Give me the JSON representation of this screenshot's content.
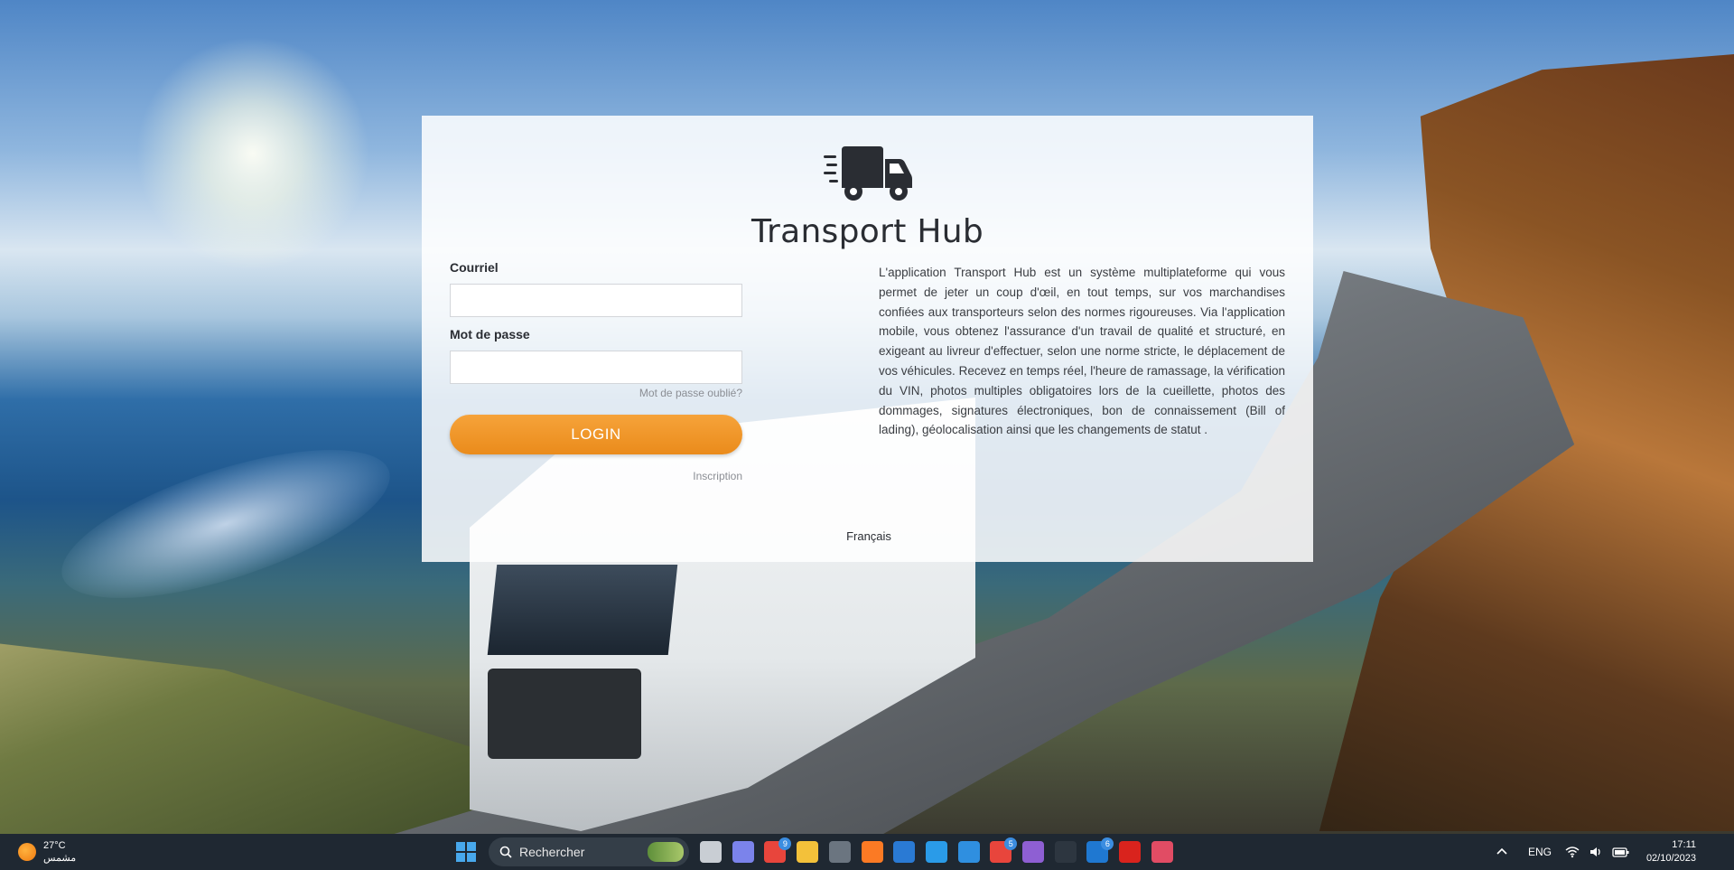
{
  "app": {
    "title": "Transport Hub",
    "logo_icon": "truck-icon",
    "accent_color": "#EE921F"
  },
  "form": {
    "email_label": "Courriel",
    "email_value": "",
    "password_label": "Mot de passe",
    "password_value": "",
    "forgot_password": "Mot de passe oublié?",
    "login_button": "LOGIN",
    "signup_link": "Inscription"
  },
  "description": "L'application Transport Hub est un système multiplateforme qui vous permet de jeter un coup d'œil, en tout temps, sur vos marchandises confiées aux transporteurs selon des normes rigoureuses. Via l'application mobile, vous obtenez l'assurance d'un travail de qualité et structuré, en exigeant au livreur d'effectuer, selon une norme stricte, le déplacement de vos véhicules. Recevez en temps réel, l'heure de ramassage, la vérification du VIN, photos multiples obligatoires lors de la cueillette, photos des dommages, signatures électroniques, bon de connaissement (Bill of lading), géolocalisation ainsi que les changements de statut .",
  "language": "Français",
  "taskbar": {
    "weather_temp": "27°C",
    "weather_desc": "مشمس",
    "search_placeholder": "Rechercher",
    "apps": [
      {
        "name": "task-view-icon",
        "color": "#c9ced4"
      },
      {
        "name": "teams-icon",
        "color": "#7b83eb"
      },
      {
        "name": "chrome-icon",
        "color": "#e8453c",
        "badge": "9"
      },
      {
        "name": "file-explorer-icon",
        "color": "#f3c13a"
      },
      {
        "name": "calculator-icon",
        "color": "#6b7580"
      },
      {
        "name": "xampp-icon",
        "color": "#fb7a24"
      },
      {
        "name": "mail-icon",
        "color": "#2a7ad4"
      },
      {
        "name": "vscode-icon",
        "color": "#2a9be8"
      },
      {
        "name": "sync-app-icon",
        "color": "#2f8fe0"
      },
      {
        "name": "chrome-profile-icon",
        "color": "#e8453c",
        "badge": "5"
      },
      {
        "name": "github-icon",
        "color": "#8e5fd3"
      },
      {
        "name": "terminal-icon",
        "color": "#2d3640"
      },
      {
        "name": "outlook-icon",
        "color": "#1f78d1",
        "badge": "6"
      },
      {
        "name": "acrobat-icon",
        "color": "#d9231d"
      },
      {
        "name": "snipping-tool-icon",
        "color": "#e14c64"
      }
    ],
    "language": "ENG",
    "time": "17:11",
    "date": "02/10/2023"
  }
}
